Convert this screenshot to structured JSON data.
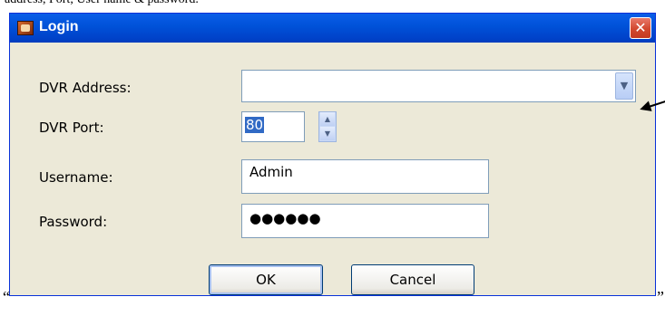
{
  "page_snippet": "address, Port, User name & password.",
  "window": {
    "title": "Login",
    "close_glyph": "✕",
    "icon": "app-icon"
  },
  "form": {
    "dvr_address_label": "DVR Address:",
    "dvr_address_value": "",
    "dvr_port_label": "DVR Port:",
    "dvr_port_value": "80",
    "username_label": "Username:",
    "username_value": "Admin",
    "password_label": "Password:",
    "password_value": "●●●●●●"
  },
  "buttons": {
    "ok": "OK",
    "cancel": "Cancel"
  },
  "quotes": {
    "open": "“",
    "close": "”"
  },
  "colors": {
    "title_bar": "#0054e3",
    "dialog_bg": "#ece9d8",
    "close_red": "#d2482e",
    "selection": "#316ac5"
  }
}
